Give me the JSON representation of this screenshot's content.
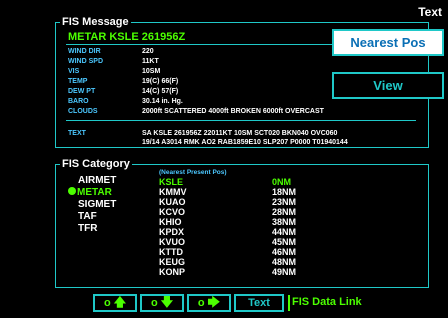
{
  "corner_label": "Text",
  "fis_message": {
    "title": "FIS Message",
    "metar_header": "METAR KSLE 261956Z",
    "fields": [
      {
        "label": "WIND DIR",
        "value": "220"
      },
      {
        "label": "WIND SPD",
        "value": "11KT"
      },
      {
        "label": "VIS",
        "value": "10SM"
      },
      {
        "label": "TEMP",
        "value": "19(C) 66(F)"
      },
      {
        "label": "DEW PT",
        "value": "14(C) 57(F)"
      },
      {
        "label": "BARO",
        "value": "30.14 in. Hg."
      },
      {
        "label": "CLOUDS",
        "value": "2000ft SCATTERED    4000ft BROKEN    6000ft OVERCAST"
      }
    ],
    "text_label": "TEXT",
    "text_value_line1": "SA KSLE 261956Z 22011KT 10SM SCT020 BKN040 OVC060",
    "text_value_line2": "19/14 A3014 RMK AO2 RAB1859E10 SLP207 P0000 T01940144"
  },
  "buttons": {
    "nearest_pos": "Nearest Pos",
    "view": "View"
  },
  "fis_category": {
    "title": "FIS Category",
    "items": [
      "AIRMET",
      "METAR",
      "SIGMET",
      "TAF",
      "TFR"
    ],
    "selected_index": 1,
    "nearest_header": "(Nearest Present Pos)",
    "stations": [
      {
        "id": "KSLE",
        "dist": "0NM",
        "selected": true
      },
      {
        "id": "KMMV",
        "dist": "18NM"
      },
      {
        "id": "KUAO",
        "dist": "23NM"
      },
      {
        "id": "KCVO",
        "dist": "28NM"
      },
      {
        "id": "KHIO",
        "dist": "38NM"
      },
      {
        "id": "KPDX",
        "dist": "44NM"
      },
      {
        "id": "KVUO",
        "dist": "45NM"
      },
      {
        "id": "KTTD",
        "dist": "46NM"
      },
      {
        "id": "KEUG",
        "dist": "48NM"
      },
      {
        "id": "KONP",
        "dist": "49NM"
      }
    ]
  },
  "softkeys": {
    "up_label": "o",
    "down_label": "o",
    "right_label": "o",
    "text_label": "Text",
    "status": "FIS Data Link"
  },
  "colors": {
    "accent": "#1fc8c8",
    "green": "#4cff00",
    "label_blue": "#4cc8ff"
  }
}
